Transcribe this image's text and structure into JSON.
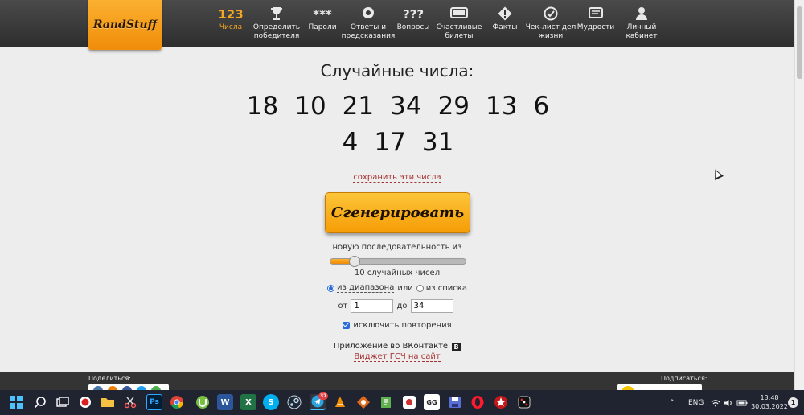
{
  "logo": "RandStuff",
  "nav": [
    {
      "icon_text": "123",
      "label": "Числа",
      "active": true
    },
    {
      "icon_text": "🏆",
      "label": "Определить победителя"
    },
    {
      "icon_text": "***",
      "label": "Пароли"
    },
    {
      "icon_text": "◉",
      "label": "Ответы и предсказания"
    },
    {
      "icon_text": "???",
      "label": "Вопросы"
    },
    {
      "icon_text": "▭",
      "label": "Счастливые билеты"
    },
    {
      "icon_text": "!",
      "label": "Факты"
    },
    {
      "icon_text": "✔",
      "label": "Чек-лист дел жизни"
    },
    {
      "icon_text": "📜",
      "label": "Мудрости"
    },
    {
      "icon_text": "👤",
      "label": "Личный кабинет"
    }
  ],
  "main": {
    "title": "Случайные числа:",
    "numbers": [
      "18",
      "10",
      "21",
      "34",
      "29",
      "13",
      "6",
      "4",
      "17",
      "31"
    ],
    "save_link": "сохранить эти числа",
    "generate_button": "Сгенерировать",
    "sequence_label": "новую последовательность из",
    "slider_fraction": 0.18,
    "count_label": "10 случайных чисел",
    "mode": {
      "range_label": "из диапазона",
      "or": "или",
      "list_label": "из списка",
      "selected": "range"
    },
    "range": {
      "from_label": "от",
      "from_value": "1",
      "to_label": "до",
      "to_value": "34"
    },
    "exclude_repeats_label": "исключить повторения",
    "exclude_repeats_checked": true,
    "vk_app_link": "Приложение во ВКонтакте",
    "vk_badge": "В",
    "widget_link": "Виджет ГСЧ на сайт"
  },
  "footer": {
    "share_label": "Поделиться:",
    "subscribe_label": "Подписаться:"
  },
  "taskbar": {
    "apps": [
      "windows-start",
      "search",
      "task-view",
      "record",
      "file-explorer",
      "scissors",
      "photoshop",
      "chrome",
      "utorrent",
      "word",
      "excel",
      "skype",
      "steam",
      "telegram",
      "vlc",
      "game-app",
      "notepad-app",
      "media-app",
      "gg-app",
      "save-app",
      "opera",
      "pokerstars",
      "dice-app"
    ],
    "ps_label": "Ps",
    "w_label": "W",
    "x_label": "X",
    "s_label": "S",
    "gg_label": "GG",
    "telegram_badge": "37",
    "tray_chevron": "^",
    "language": "ENG",
    "time": "13:48",
    "date": "30.03.2022",
    "notification_count": "1"
  },
  "colors": {
    "accent": "#f5a623",
    "nav_bg": "#3a3a3a",
    "page_bg": "#ededed",
    "link_red": "#a83232"
  }
}
